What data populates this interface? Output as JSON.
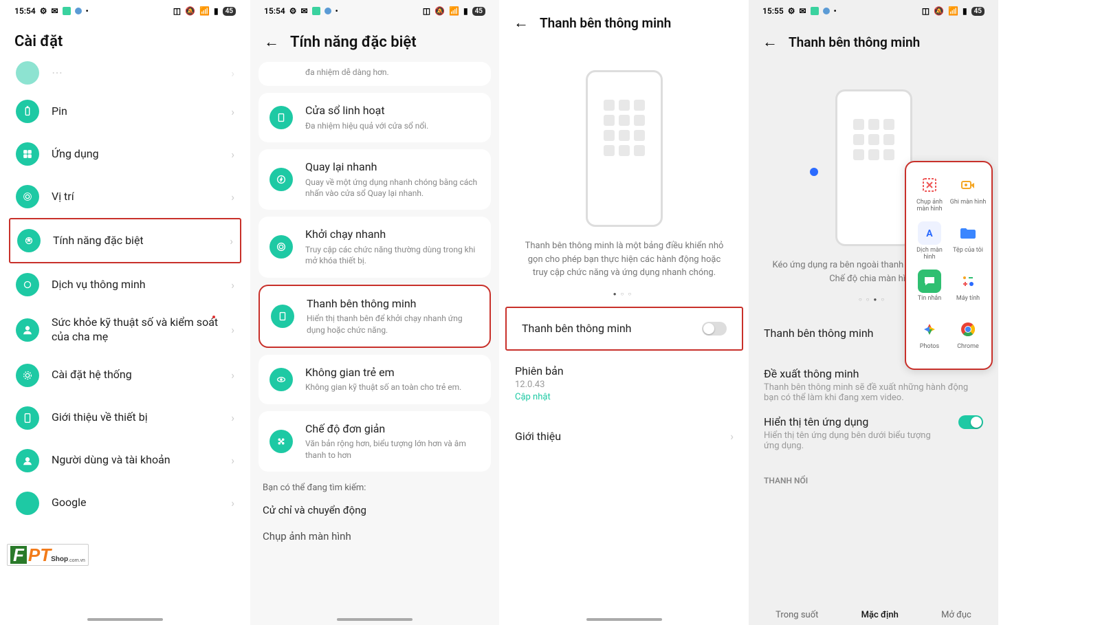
{
  "status": {
    "time1": "15:54",
    "time2": "15:55",
    "battery": "45"
  },
  "s1": {
    "title": "Cài đặt",
    "items": [
      {
        "label": "Pin"
      },
      {
        "label": "Ứng dụng"
      },
      {
        "label": "Vị trí"
      },
      {
        "label": "Tính năng đặc biệt",
        "highlight": true
      },
      {
        "label": "Dịch vụ thông minh"
      },
      {
        "label": "Sức khỏe kỹ thuật số và kiểm soát của cha mẹ",
        "dot": true
      },
      {
        "label": "Cài đặt hệ thống"
      },
      {
        "label": "Giới thiệu về thiết bị"
      },
      {
        "label": "Người dùng và tài khoản"
      },
      {
        "label": "Google"
      }
    ]
  },
  "s2": {
    "title": "Tính năng đặc biệt",
    "truncated": "đa nhiệm dễ dàng hơn.",
    "items": [
      {
        "t": "Cửa sổ linh hoạt",
        "s": "Đa nhiệm hiệu quả với cửa sổ nổi."
      },
      {
        "t": "Quay lại nhanh",
        "s": "Quay về một ứng dụng nhanh chóng bằng cách nhấn vào cửa sổ Quay lại nhanh."
      },
      {
        "t": "Khởi chạy nhanh",
        "s": "Truy cập các chức năng thường dùng trong khi mở khóa thiết bị."
      },
      {
        "t": "Thanh bên thông minh",
        "s": "Hiển thị thanh bên để khởi chạy nhanh ứng dụng hoặc chức năng.",
        "highlight": true
      },
      {
        "t": "Không gian trẻ em",
        "s": "Không gian kỹ thuật số an toàn cho trẻ em."
      },
      {
        "t": "Chế độ đơn giản",
        "s": "Văn bản rộng hơn, biểu tượng lớn hơn và âm thanh to hơn"
      }
    ],
    "search_hdr": "Bạn có thể đang tìm kiếm:",
    "search_links": [
      "Cử chỉ và chuyển động",
      "Chụp ảnh màn hình"
    ]
  },
  "s3": {
    "title": "Thanh bên thông minh",
    "desc": "Thanh bên thông minh là một bảng điều khiển nhỏ gọn cho phép bạn thực hiện các hành động hoặc truy cập chức năng và ứng dụng nhanh chóng.",
    "toggle_label": "Thanh bên thông minh",
    "version_label": "Phiên bản",
    "version": "12.0.43",
    "update": "Cập nhật",
    "about": "Giới thiệu"
  },
  "s4": {
    "title": "Thanh bên thông minh",
    "desc": "Kéo ứng dụng ra bên ngoài thanh bên để sử dụng ở Chế độ chia màn hình.",
    "toggle_label": "Thanh bên thông minh",
    "suggest_t": "Đề xuất thông minh",
    "suggest_s": "Thanh bên thông minh sẽ đề xuất những hành động bạn có thể làm khi đang xem video.",
    "names_t": "Hiển thị tên ứng dụng",
    "names_s": "Hiển thị tên ứng dụng bên dưới biểu tượng ứng dụng.",
    "bar_section": "THANH NỔI",
    "opts": [
      "Trong suốt",
      "Mặc định",
      "Mở đục"
    ]
  },
  "apps": [
    {
      "label": "Chụp ảnh màn hình",
      "icon": "screenshot",
      "col": "#e55"
    },
    {
      "label": "Ghi màn hình",
      "icon": "record",
      "col": "#f5a623"
    },
    {
      "label": "Dịch màn hình",
      "icon": "translate",
      "col": "#2b6bff"
    },
    {
      "label": "Tệp của tôi",
      "icon": "folder",
      "col": "#3a86ff"
    },
    {
      "label": "Tin nhắn",
      "icon": "messages",
      "col": "#2fbf71"
    },
    {
      "label": "Máy tính",
      "icon": "calc",
      "col": "#5b9bd5"
    },
    {
      "label": "Photos",
      "icon": "photos",
      "col": ""
    },
    {
      "label": "Chrome",
      "icon": "chrome",
      "col": ""
    }
  ],
  "watermark": {
    "f": "F",
    "pt": "PT",
    "shop": "Shop",
    "domain": ".com.vn"
  }
}
